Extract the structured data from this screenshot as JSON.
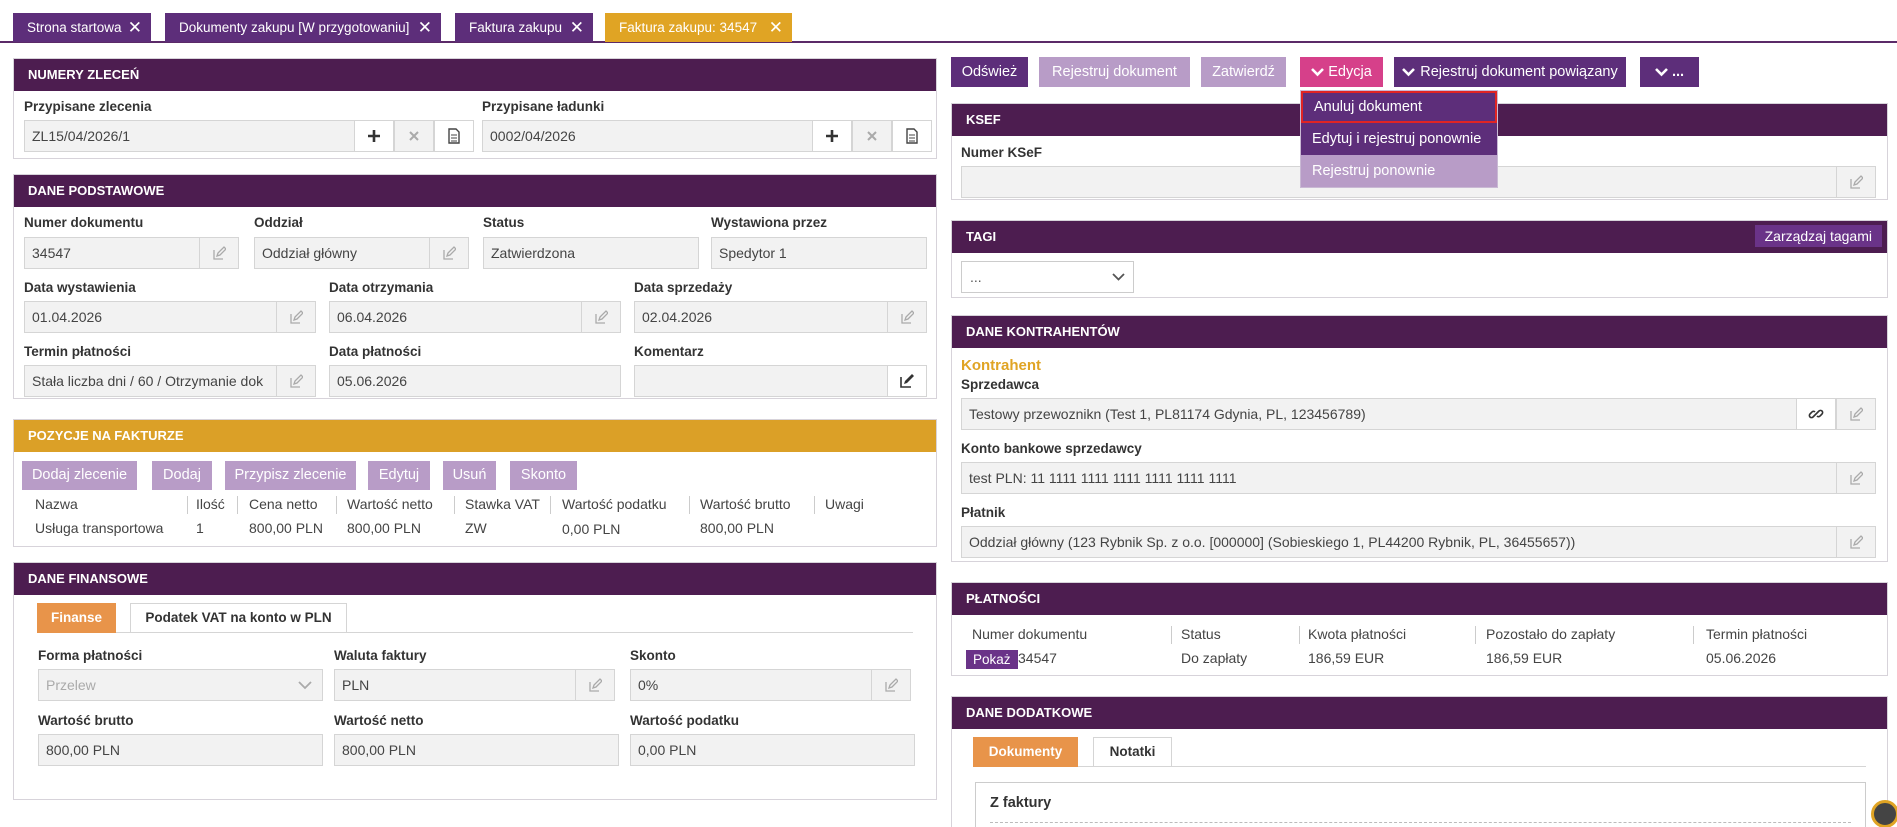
{
  "tabs": [
    {
      "label": "Strona startowa",
      "close": "✕"
    },
    {
      "label": "Dokumenty zakupu [W przygotowaniu]",
      "close": "✕"
    },
    {
      "label": "Faktura zakupu",
      "close": "✕"
    },
    {
      "label": "Faktura zakupu: 34547",
      "close": "✕"
    }
  ],
  "numery": {
    "title": "NUMERY ZLECEŃ",
    "zlecenia_label": "Przypisane zlecenia",
    "zlecenia_value": "ZL15/04/2026/1",
    "ladunki_label": "Przypisane ładunki",
    "ladunki_value": "0002/04/2026"
  },
  "podstawowe": {
    "title": "DANE PODSTAWOWE",
    "numer_label": "Numer dokumentu",
    "numer_value": "34547",
    "oddzial_label": "Oddział",
    "oddzial_value": "Oddział główny",
    "status_label": "Status",
    "status_value": "Zatwierdzona",
    "wystawiona_label": "Wystawiona przez",
    "wystawiona_value": "Spedytor 1",
    "data_wyst_label": "Data wystawienia",
    "data_wyst_value": "01.04.2026",
    "data_otrz_label": "Data otrzymania",
    "data_otrz_value": "06.04.2026",
    "data_sprz_label": "Data sprzedaży",
    "data_sprz_value": "02.04.2026",
    "termin_label": "Termin płatności",
    "termin_value": "Stała liczba dni / 60 / Otrzymanie dok",
    "data_plat_label": "Data płatności",
    "data_plat_value": "05.06.2026",
    "komentarz_label": "Komentarz",
    "komentarz_value": ""
  },
  "pozycje": {
    "title": "POZYCJE NA FAKTURZE",
    "buttons": [
      "Dodaj zlecenie",
      "Dodaj",
      "Przypisz zlecenie",
      "Edytuj",
      "Usuń",
      "Skonto"
    ],
    "columns": [
      "Nazwa",
      "Ilość",
      "Cena netto",
      "Wartość netto",
      "Stawka VAT",
      "Wartość podatku",
      "Wartość brutto",
      "Uwagi"
    ],
    "rows": [
      [
        "Usługa transportowa",
        "1",
        "800,00 PLN",
        "800,00 PLN",
        "ZW",
        "0,00 PLN",
        "800,00 PLN",
        ""
      ]
    ]
  },
  "finansowe": {
    "title": "DANE FINANSOWE",
    "tab_finanse": "Finanse",
    "tab_vat": "Podatek VAT na konto w PLN",
    "forma_label": "Forma płatności",
    "forma_value": "Przelew",
    "waluta_label": "Waluta faktury",
    "waluta_value": "PLN",
    "skonto_label": "Skonto",
    "skonto_value": "0%",
    "brutto_label": "Wartość brutto",
    "brutto_value": "800,00 PLN",
    "netto_label": "Wartość netto",
    "netto_value": "800,00 PLN",
    "podatek_label": "Wartość podatku",
    "podatek_value": "0,00 PLN"
  },
  "toolbar": {
    "odswiez": "Odśwież",
    "rejestruj": "Rejestruj dokument",
    "zatwierdz": "Zatwierdź",
    "edycja": "Edycja",
    "rejestruj_powiazany": "Rejestruj dokument powiązany",
    "more": "..."
  },
  "dropdown": {
    "items": [
      "Anuluj dokument",
      "Edytuj i rejestruj ponownie",
      "Rejestruj ponownie"
    ]
  },
  "ksef": {
    "title": "KSEF",
    "numer_label": "Numer KSeF",
    "numer_value": ""
  },
  "tagi": {
    "title": "TAGI",
    "manage_label": "Zarządzaj tagami",
    "select_value": "..."
  },
  "kontrahenci": {
    "title": "DANE KONTRAHENTÓW",
    "section": "Kontrahent",
    "sprzedawca_label": "Sprzedawca",
    "sprzedawca_value": "Testowy przewoznikn (Test 1, PL81174 Gdynia, PL, 123456789)",
    "konto_label": "Konto bankowe sprzedawcy",
    "konto_value": "test PLN: 11 1111 1111 1111 1111 1111 1111",
    "platnik_label": "Płatnik",
    "platnik_value": "Oddział główny (123 Rybnik Sp. z o.o. [000000] (Sobieskiego 1, PL44200 Rybnik, PL, 36455657))"
  },
  "platnosci": {
    "title": "PŁATNOŚCI",
    "columns": [
      "Numer dokumentu",
      "Status",
      "Kwota płatności",
      "Pozostało do zapłaty",
      "Termin płatności"
    ],
    "show_label": "Pokaż",
    "row": [
      "34547",
      "Do zapłaty",
      "186,59 EUR",
      "186,59 EUR",
      "05.06.2026"
    ]
  },
  "dodatkowe": {
    "title": "DANE DODATKOWE",
    "tab_dokumenty": "Dokumenty",
    "tab_notatki": "Notatki",
    "z_faktury": "Z faktury"
  },
  "colors": {
    "purple_dark": "#4d1d50",
    "purple_tab": "#5d2e7a",
    "gold": "#dba027",
    "button_light": "#b89cc7",
    "pink": "#d6408a"
  }
}
